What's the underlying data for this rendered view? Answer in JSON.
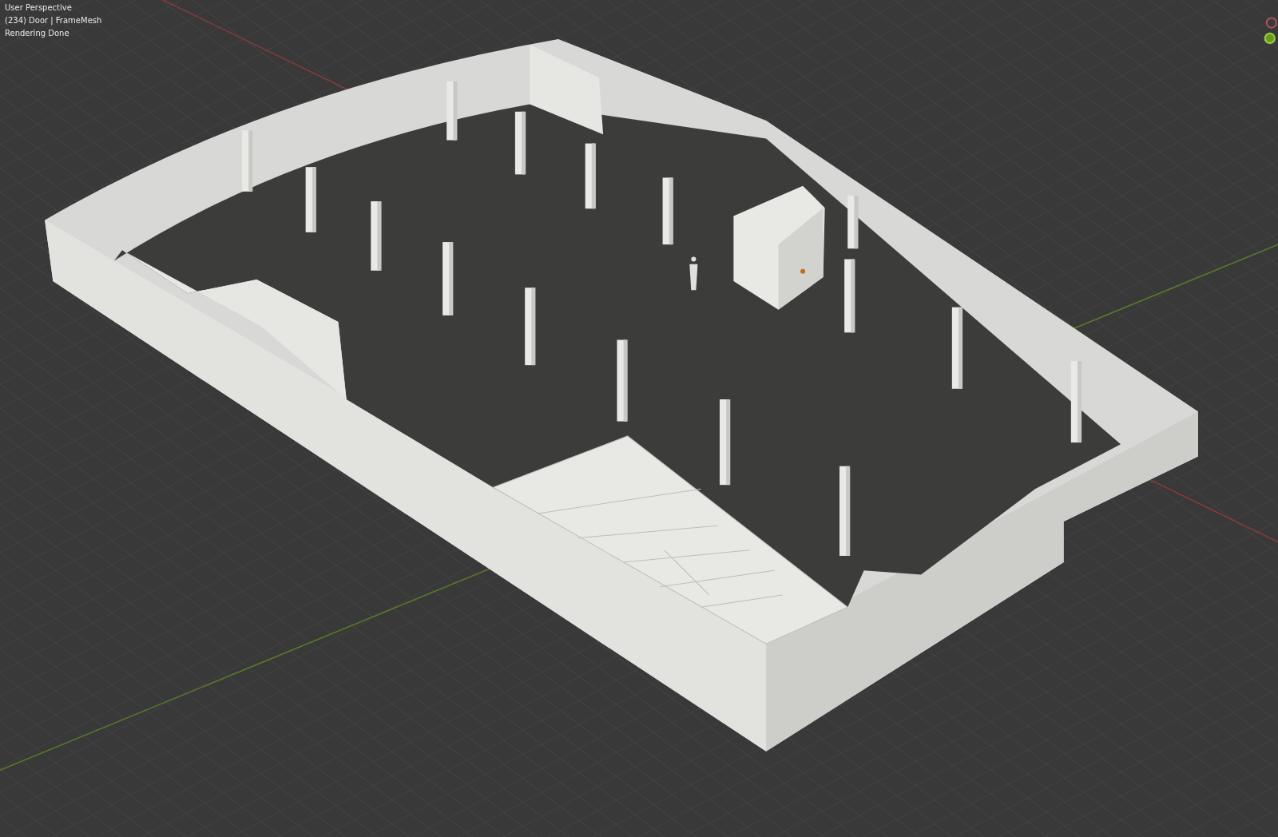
{
  "viewport": {
    "overlay_lines": [
      "User Perspective",
      "(234) Door | FrameMesh",
      "Rendering Done"
    ]
  }
}
